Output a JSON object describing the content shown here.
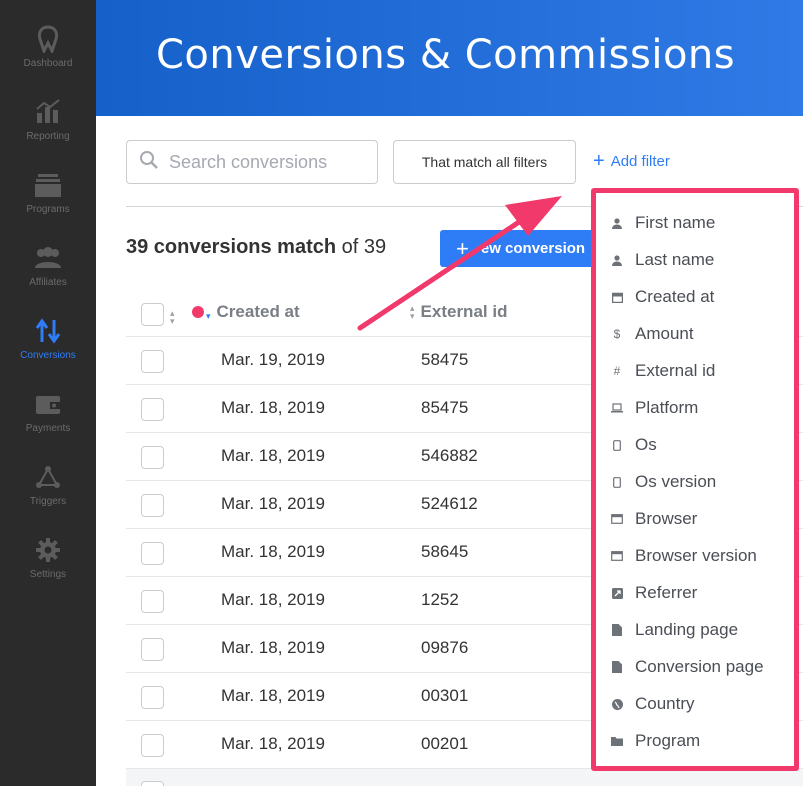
{
  "sidebar": {
    "items": [
      {
        "label": "Dashboard",
        "icon": "dashboard-icon"
      },
      {
        "label": "Reporting",
        "icon": "reporting-icon"
      },
      {
        "label": "Programs",
        "icon": "programs-icon"
      },
      {
        "label": "Affiliates",
        "icon": "affiliates-icon"
      },
      {
        "label": "Conversions",
        "icon": "conversions-icon",
        "active": true
      },
      {
        "label": "Payments",
        "icon": "payments-icon"
      },
      {
        "label": "Triggers",
        "icon": "triggers-icon"
      },
      {
        "label": "Settings",
        "icon": "settings-icon"
      }
    ]
  },
  "header": {
    "title": "Conversions & Commissions"
  },
  "filters": {
    "search_placeholder": "Search conversions",
    "match_label": "That match all filters",
    "add_filter_label": "Add filter"
  },
  "summary": {
    "count_bold": "39 conversions match",
    "count_rest": " of 39"
  },
  "new_conversion_label": "ew conversion",
  "table": {
    "headers": {
      "created_at": "Created at",
      "external_id": "External id"
    },
    "rows": [
      {
        "created_at": "Mar. 19, 2019",
        "external_id": "58475"
      },
      {
        "created_at": "Mar. 18, 2019",
        "external_id": "85475"
      },
      {
        "created_at": "Mar. 18, 2019",
        "external_id": "546882"
      },
      {
        "created_at": "Mar. 18, 2019",
        "external_id": "524612"
      },
      {
        "created_at": "Mar. 18, 2019",
        "external_id": "58645"
      },
      {
        "created_at": "Mar. 18, 2019",
        "external_id": "1252"
      },
      {
        "created_at": "Mar. 18, 2019",
        "external_id": "09876"
      },
      {
        "created_at": "Mar. 18, 2019",
        "external_id": "00301"
      },
      {
        "created_at": "Mar. 18, 2019",
        "external_id": "00201"
      }
    ]
  },
  "filter_menu": {
    "items": [
      {
        "label": "First name",
        "icon": "user-icon"
      },
      {
        "label": "Last name",
        "icon": "user-icon"
      },
      {
        "label": "Created at",
        "icon": "calendar-icon"
      },
      {
        "label": "Amount",
        "icon": "dollar-icon"
      },
      {
        "label": "External id",
        "icon": "hash-icon"
      },
      {
        "label": "Platform",
        "icon": "laptop-icon"
      },
      {
        "label": "Os",
        "icon": "mobile-icon"
      },
      {
        "label": "Os version",
        "icon": "mobile-icon"
      },
      {
        "label": "Browser",
        "icon": "browser-window-icon"
      },
      {
        "label": "Browser version",
        "icon": "browser-window-icon"
      },
      {
        "label": "Referrer",
        "icon": "external-link-icon"
      },
      {
        "label": "Landing page",
        "icon": "file-icon"
      },
      {
        "label": "Conversion page",
        "icon": "file-icon"
      },
      {
        "label": "Country",
        "icon": "globe-icon"
      },
      {
        "label": "Program",
        "icon": "folder-icon"
      }
    ]
  },
  "colors": {
    "accent": "#2f7df6",
    "sidebar_bg": "#2b2b2b",
    "highlight": "#f2396b",
    "header_from": "#1560c9",
    "header_to": "#2f7ae6"
  }
}
